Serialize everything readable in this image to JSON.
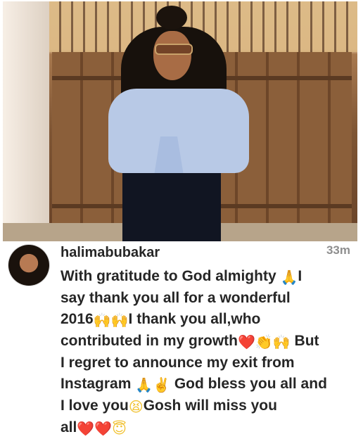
{
  "post": {
    "username": "halimabubakar",
    "time_ago": "33m",
    "caption_lines": [
      [
        "With gratitude to God almighty ",
        "🙏",
        "I"
      ],
      [
        "say thank you all for a wonderful"
      ],
      [
        "2016",
        "🙌🙌",
        "I thank you all,who"
      ],
      [
        "contributed in my growth",
        "❤️",
        "👏🙌",
        " But"
      ],
      [
        "I regret to announce my exit from"
      ],
      [
        "Instagram ",
        "🙏",
        " ✌️",
        " God bless you all and"
      ],
      [
        "I love you",
        "😫",
        "Gosh will miss you"
      ],
      [
        "all",
        "❤️",
        "❤️",
        "😇"
      ]
    ]
  }
}
